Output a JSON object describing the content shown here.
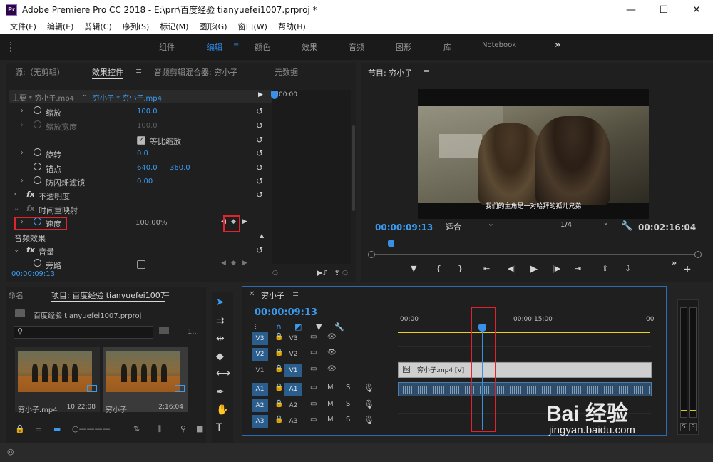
{
  "window": {
    "title": "Adobe Premiere Pro CC 2018 - E:\\prr\\百度经验 tianyuefei1007.prproj *",
    "logo_text": "Pr",
    "controls": [
      "—",
      "☐",
      "✕"
    ]
  },
  "menu": [
    "文件(F)",
    "编辑(E)",
    "剪辑(C)",
    "序列(S)",
    "标记(M)",
    "图形(G)",
    "窗口(W)",
    "帮助(H)"
  ],
  "workspaces": {
    "tabs": [
      "组件",
      "编辑",
      "颜色",
      "效果",
      "音频",
      "图形",
      "库",
      "Notebook"
    ],
    "active": "编辑",
    "more": "»"
  },
  "effect_controls": {
    "tabs": [
      "源:（无剪辑）",
      "效果控件",
      "音频剪辑混合器: 穷小子",
      "元数据"
    ],
    "master": "主要 * 穷小子.mp4",
    "sequence_clip": "穷小子 * 穷小子.mp4",
    "time_start": ":00:00",
    "properties": [
      {
        "label": "缩放",
        "value": "100.0"
      },
      {
        "label": "缩放宽度",
        "value": "100.0"
      },
      {
        "label": "等比缩放"
      },
      {
        "label": "旋转",
        "value": "0.0"
      },
      {
        "label": "锚点",
        "value": "640.0",
        "value2": "360.0"
      },
      {
        "label": "防闪烁滤镜",
        "value": "0.00"
      },
      {
        "label": "不透明度"
      },
      {
        "label": "时间重映射"
      },
      {
        "label": "速度",
        "value": "100.00%"
      },
      {
        "label": "音频效果"
      },
      {
        "label": "音量"
      },
      {
        "label": "旁路"
      }
    ],
    "current_time": "00:00:09:13"
  },
  "program": {
    "title": "节目: 穷小子",
    "subtitle": "我们的主角是一对哈拜的孤儿兄弟",
    "timecode": "00:00:09:13",
    "fit": "适合",
    "resolution": "1/4",
    "duration": "00:02:16:04"
  },
  "project": {
    "tabs": [
      "命名",
      "项目: 百度经验 tianyuefei1007"
    ],
    "file": "百度经验 tianyuefei1007.prproj",
    "item_count": "1...",
    "clips": [
      {
        "name": "穷小子.mp4",
        "duration": "10:22:08"
      },
      {
        "name": "穷小子",
        "duration": "2:16:04"
      }
    ]
  },
  "timeline": {
    "sequence": "穷小子",
    "timecode": "00:00:09:13",
    "ruler": [
      ":00:00",
      "00:00:15:00",
      "00"
    ],
    "video_tracks": [
      "V3",
      "V2",
      "V1"
    ],
    "audio_tracks": [
      "A1",
      "A2",
      "A3"
    ],
    "clip_label": "穷小子.mp4 [V]",
    "fx_badge": "fx",
    "audio_controls": [
      "M",
      "S"
    ]
  },
  "meter": {
    "solo": [
      "S",
      "S"
    ]
  },
  "watermark": {
    "brand": "Bai 经验",
    "url": "jingyan.baidu.com"
  },
  "colors": {
    "accent": "#3a9cf0",
    "highlight": "#e0232c",
    "target": "#2b5e8c",
    "in_out": "#e8d21f"
  }
}
